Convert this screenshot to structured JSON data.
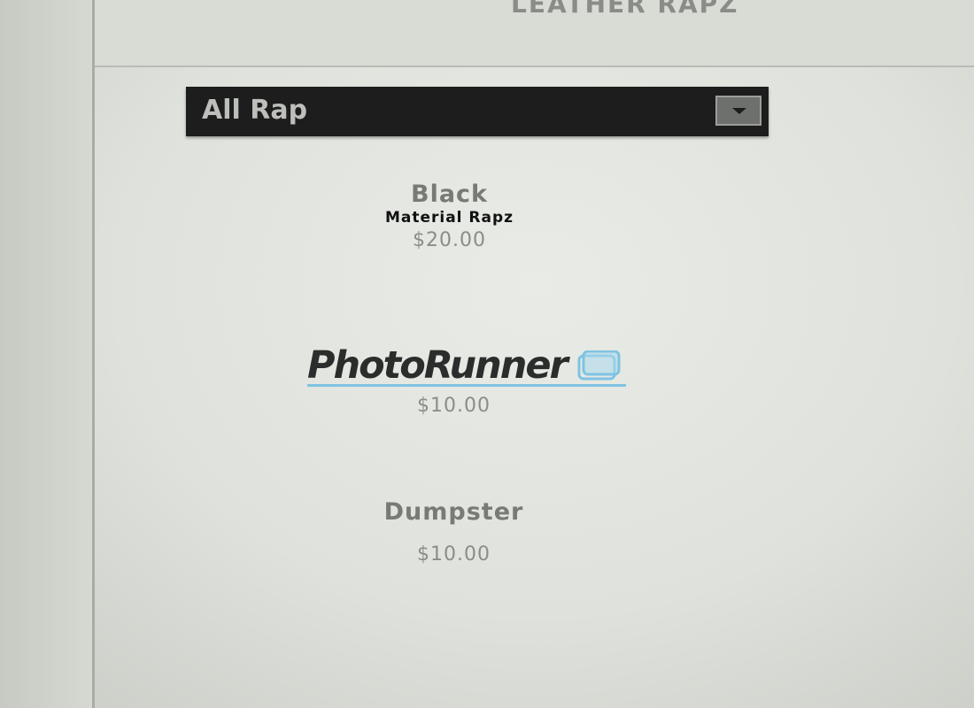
{
  "header": {
    "title": "LEATHER RAPZ"
  },
  "category_select": {
    "value": "All Rap"
  },
  "products": [
    {
      "name": "Black",
      "subtitle": "Material Rapz",
      "price": "$20.00"
    },
    {
      "name": "",
      "price": "$10.00"
    },
    {
      "name": "Dumpster",
      "price": "$10.00"
    }
  ],
  "watermark": {
    "text": "PhotoRunner"
  },
  "colors": {
    "page_background": "#e3e6e0",
    "select_background": "#1c1d1c",
    "watermark_accent": "#7fc3e3"
  }
}
